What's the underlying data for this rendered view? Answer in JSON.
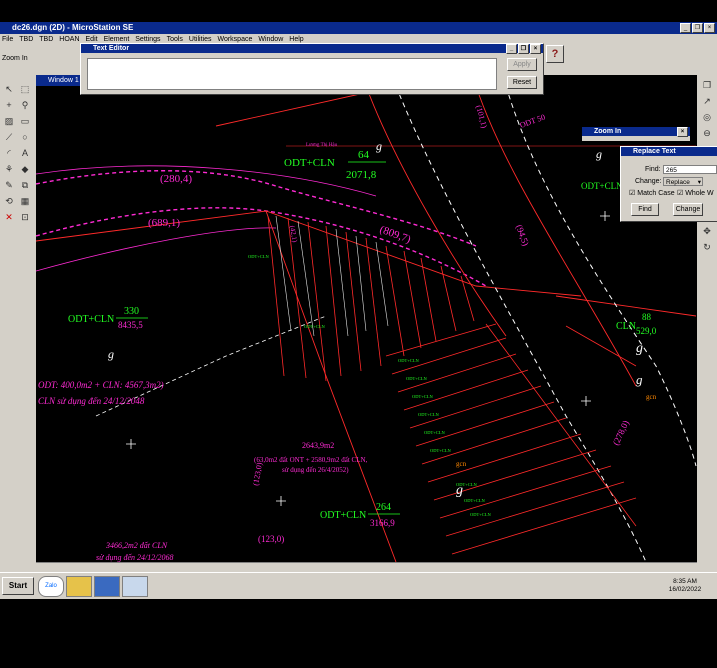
{
  "app": {
    "title": "dc26.dgn (2D) - MicroStation SE",
    "status_command": "Zoom In",
    "menu": [
      "File",
      "TBD",
      "TBD",
      "HOAN",
      "Edit",
      "Element",
      "Settings",
      "Tools",
      "Utilities",
      "Workspace",
      "Window",
      "Help"
    ],
    "view_title": "Window 1"
  },
  "text_editor": {
    "title": "Text Editor",
    "value": "",
    "apply_label": "Apply",
    "reset_label": "Reset"
  },
  "help_glyph": "?",
  "zoom_dialog": {
    "title": "Zoom In"
  },
  "replace_dialog": {
    "title": "Replace Text",
    "find_label": "Find:",
    "find_value": "265",
    "change_label": "Change:",
    "change_mode": "Replace",
    "match_case_label": "Match Case",
    "whole_word_label": "Whole W",
    "find_button": "Find",
    "change_button": "Change"
  },
  "taskbar": {
    "start_label": "Start",
    "tasks": [
      "Zalo",
      "",
      "",
      ""
    ],
    "time": "8:35 AM",
    "date": "16/02/2022"
  },
  "map": {
    "parcel_64": {
      "label": "ODT+CLN",
      "number": "64",
      "area": "2071,8",
      "owner": "Lương Thị Hậu"
    },
    "parcel_330": {
      "label": "ODT+CLN",
      "number": "330",
      "area": "8435,5"
    },
    "parcel_264": {
      "label": "ODT+CLN",
      "number": "264",
      "area": "3166,9"
    },
    "parcel_88": {
      "label": "CLN",
      "number": "88",
      "area": "529,0"
    },
    "road_lengths": [
      "(280,4)",
      "(689,1)",
      "(809,7)",
      "(94,5)",
      "(278,0)",
      "(123,0)",
      "(42,1)",
      "(101,1)"
    ],
    "odt_50": "ODT 50",
    "land_note_1": "ODT: 400,0m2 + CLN: 4567,3m2)",
    "land_note_2": "CLN sử dụng đến 24/12/2048",
    "land_note_3": "2643,9m2",
    "land_note_4": "(63,0m2 đất ONT + 2580,9m2 đất CLN,",
    "land_note_5": "sử dụng đến 26/4/2052)",
    "land_note_6": "3466,2m2 đất CLN",
    "land_note_7": "sử dụng đến 24/12/2068",
    "land_note_8": "gcn",
    "small_odt": "ODT+CLN",
    "g_mark": "g"
  },
  "colors": {
    "title_blue": "#0a2a8c",
    "dialog_gray": "#d4d0c8",
    "map_magenta": "#ff2bd4",
    "map_green": "#22ff22",
    "map_red": "#ff2a2a",
    "map_white": "#ffffff"
  }
}
